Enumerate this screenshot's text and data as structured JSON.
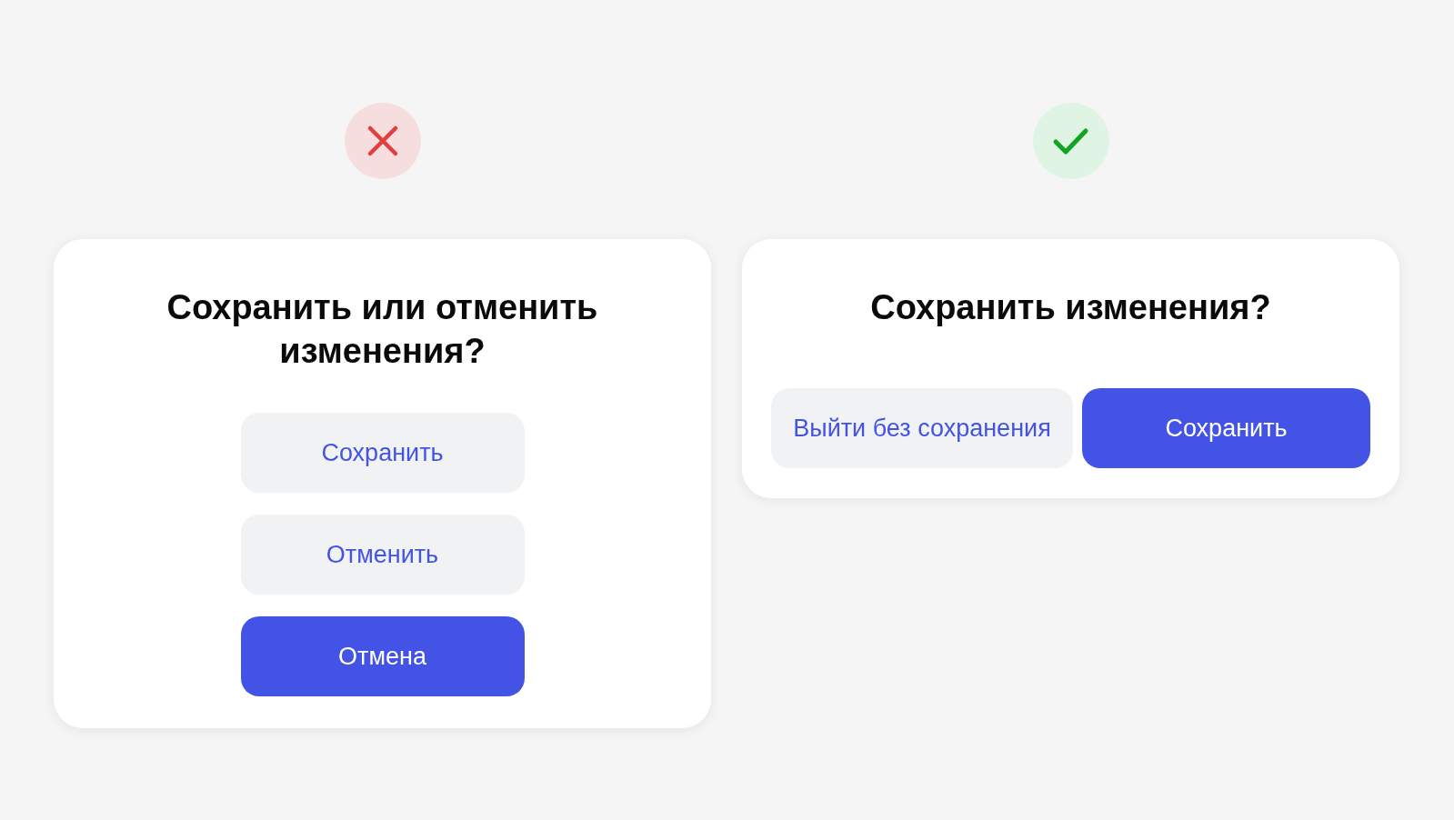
{
  "examples": [
    {
      "approved": false,
      "dialog": {
        "buttons_stacked": true,
        "title": "Сохранить или отменить изменения?",
        "buttons": [
          {
            "label": "Сохранить",
            "kind": "secondary"
          },
          {
            "label": "Отменить",
            "kind": "secondary"
          },
          {
            "label": "Отмена",
            "kind": "primary"
          }
        ]
      }
    },
    {
      "approved": true,
      "dialog": {
        "buttons_stacked": false,
        "title": "Сохранить изменения?",
        "buttons": [
          {
            "label": "Выйти без сохранения",
            "kind": "secondary"
          },
          {
            "label": "Сохранить",
            "kind": "primary"
          }
        ]
      }
    }
  ]
}
